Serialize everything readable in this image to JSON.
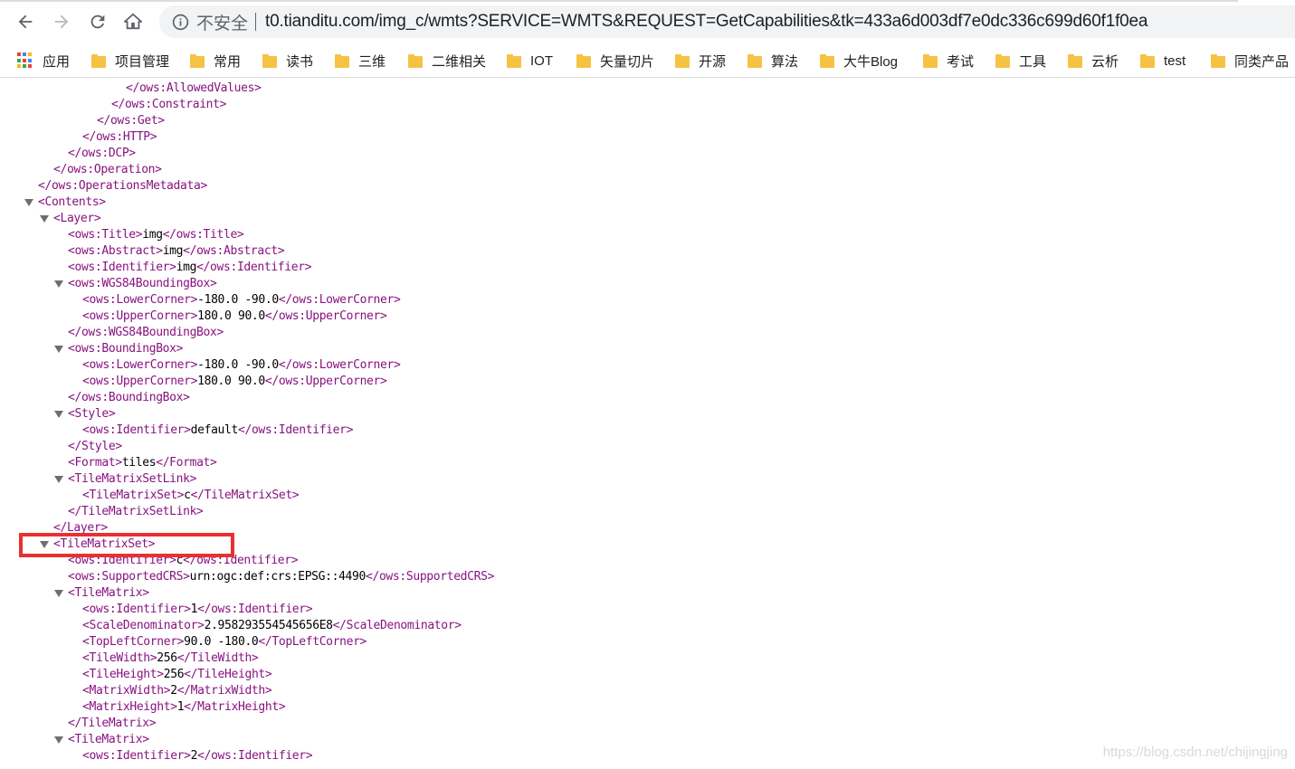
{
  "browser": {
    "security_label": "不安全",
    "url": "t0.tianditu.com/img_c/wmts?SERVICE=WMTS&REQUEST=GetCapabilities&tk=433a6d003df7e0dc336c699d60f1f0ea",
    "nav_icons": [
      "back-arrow-icon",
      "forward-arrow-icon",
      "reload-icon",
      "home-icon",
      "info-icon"
    ]
  },
  "bookmarks": [
    {
      "label": "应用",
      "icon": "apps-grid-icon"
    },
    {
      "label": "项目管理",
      "icon": "folder-icon"
    },
    {
      "label": "常用",
      "icon": "folder-icon"
    },
    {
      "label": "读书",
      "icon": "folder-icon"
    },
    {
      "label": "三维",
      "icon": "folder-icon"
    },
    {
      "label": "二维相关",
      "icon": "folder-icon"
    },
    {
      "label": "IOT",
      "icon": "folder-icon"
    },
    {
      "label": "矢量切片",
      "icon": "folder-icon"
    },
    {
      "label": "开源",
      "icon": "folder-icon"
    },
    {
      "label": "算法",
      "icon": "folder-icon"
    },
    {
      "label": "大牛Blog",
      "icon": "folder-icon"
    },
    {
      "label": "考试",
      "icon": "folder-icon"
    },
    {
      "label": "工具",
      "icon": "folder-icon"
    },
    {
      "label": "云析",
      "icon": "folder-icon"
    },
    {
      "label": "test",
      "icon": "folder-icon"
    },
    {
      "label": "同类产品",
      "icon": "folder-icon"
    }
  ],
  "colors": {
    "tag": "#881280",
    "text": "#000000",
    "highlight": "#e8312f",
    "folder": "#f6c243"
  },
  "xml_lines": [
    {
      "tag_open": "</ows:AllowedValues>",
      "text": "",
      "tag_close": ""
    },
    {
      "tag_open": "</ows:Constraint>",
      "text": "",
      "tag_close": ""
    },
    {
      "tag_open": "</ows:Get>",
      "text": "",
      "tag_close": ""
    },
    {
      "tag_open": "</ows:HTTP>",
      "text": "",
      "tag_close": ""
    },
    {
      "tag_open": "</ows:DCP>",
      "text": "",
      "tag_close": ""
    },
    {
      "tag_open": "</ows:Operation>",
      "text": "",
      "tag_close": ""
    },
    {
      "tag_open": "</ows:OperationsMetadata>",
      "text": "",
      "tag_close": ""
    },
    {
      "tag_open": "<Contents>",
      "text": "",
      "tag_close": "",
      "collapsible": true
    },
    {
      "tag_open": "<Layer>",
      "text": "",
      "tag_close": "",
      "collapsible": true
    },
    {
      "tag_open": "<ows:Title>",
      "text": "img",
      "tag_close": "</ows:Title>"
    },
    {
      "tag_open": "<ows:Abstract>",
      "text": "img",
      "tag_close": "</ows:Abstract>"
    },
    {
      "tag_open": "<ows:Identifier>",
      "text": "img",
      "tag_close": "</ows:Identifier>"
    },
    {
      "tag_open": "<ows:WGS84BoundingBox>",
      "text": "",
      "tag_close": "",
      "collapsible": true
    },
    {
      "tag_open": "<ows:LowerCorner>",
      "text": "-180.0 -90.0",
      "tag_close": "</ows:LowerCorner>"
    },
    {
      "tag_open": "<ows:UpperCorner>",
      "text": "180.0 90.0",
      "tag_close": "</ows:UpperCorner>"
    },
    {
      "tag_open": "</ows:WGS84BoundingBox>",
      "text": "",
      "tag_close": ""
    },
    {
      "tag_open": "<ows:BoundingBox>",
      "text": "",
      "tag_close": "",
      "collapsible": true
    },
    {
      "tag_open": "<ows:LowerCorner>",
      "text": "-180.0 -90.0",
      "tag_close": "</ows:LowerCorner>"
    },
    {
      "tag_open": "<ows:UpperCorner>",
      "text": "180.0 90.0",
      "tag_close": "</ows:UpperCorner>"
    },
    {
      "tag_open": "</ows:BoundingBox>",
      "text": "",
      "tag_close": ""
    },
    {
      "tag_open": "<Style>",
      "text": "",
      "tag_close": "",
      "collapsible": true
    },
    {
      "tag_open": "<ows:Identifier>",
      "text": "default",
      "tag_close": "</ows:Identifier>"
    },
    {
      "tag_open": "</Style>",
      "text": "",
      "tag_close": ""
    },
    {
      "tag_open": "<Format>",
      "text": "tiles",
      "tag_close": "</Format>"
    },
    {
      "tag_open": "<TileMatrixSetLink>",
      "text": "",
      "tag_close": "",
      "collapsible": true
    },
    {
      "tag_open": "<TileMatrixSet>",
      "text": "c",
      "tag_close": "</TileMatrixSet>"
    },
    {
      "tag_open": "</TileMatrixSetLink>",
      "text": "",
      "tag_close": ""
    },
    {
      "tag_open": "</Layer>",
      "text": "",
      "tag_close": ""
    },
    {
      "tag_open": "<TileMatrixSet>",
      "text": "",
      "tag_close": "",
      "collapsible": true,
      "highlighted": true
    },
    {
      "tag_open": "<ows:Identifier>",
      "text": "c",
      "tag_close": "</ows:Identifier>"
    },
    {
      "tag_open": "<ows:SupportedCRS>",
      "text": "urn:ogc:def:crs:EPSG::4490",
      "tag_close": "</ows:SupportedCRS>"
    },
    {
      "tag_open": "<TileMatrix>",
      "text": "",
      "tag_close": "",
      "collapsible": true
    },
    {
      "tag_open": "<ows:Identifier>",
      "text": "1",
      "tag_close": "</ows:Identifier>"
    },
    {
      "tag_open": "<ScaleDenominator>",
      "text": "2.958293554545656E8",
      "tag_close": "</ScaleDenominator>"
    },
    {
      "tag_open": "<TopLeftCorner>",
      "text": "90.0 -180.0",
      "tag_close": "</TopLeftCorner>"
    },
    {
      "tag_open": "<TileWidth>",
      "text": "256",
      "tag_close": "</TileWidth>"
    },
    {
      "tag_open": "<TileHeight>",
      "text": "256",
      "tag_close": "</TileHeight>"
    },
    {
      "tag_open": "<MatrixWidth>",
      "text": "2",
      "tag_close": "</MatrixWidth>"
    },
    {
      "tag_open": "<MatrixHeight>",
      "text": "1",
      "tag_close": "</MatrixHeight>"
    },
    {
      "tag_open": "</TileMatrix>",
      "text": "",
      "tag_close": ""
    },
    {
      "tag_open": "<TileMatrix>",
      "text": "",
      "tag_close": "",
      "collapsible": true
    },
    {
      "tag_open": "<ows:Identifier>",
      "text": "2",
      "tag_close": "</ows:Identifier>"
    }
  ],
  "watermark": "https://blog.csdn.net/chijingjing"
}
